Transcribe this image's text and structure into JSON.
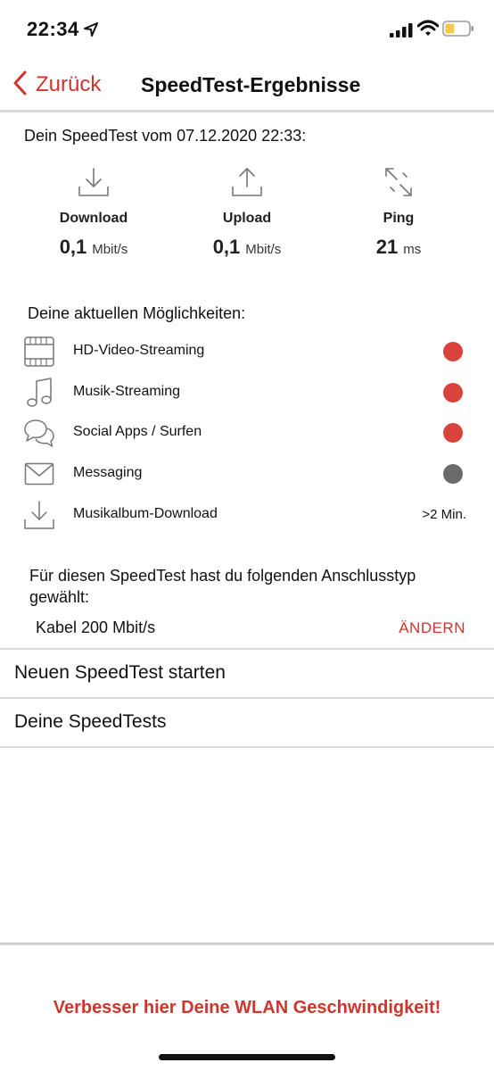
{
  "status_bar": {
    "time": "22:34",
    "location_icon": "location-arrow-icon",
    "signal_icon": "cellular-signal-icon",
    "wifi_icon": "wifi-icon",
    "battery_icon": "battery-icon",
    "battery_color": "#f2c94c"
  },
  "nav": {
    "back_label": "Zurück",
    "title": "SpeedTest-Ergebnisse"
  },
  "test": {
    "header": "Dein SpeedTest vom 07.12.2020 22:33:",
    "metrics": [
      {
        "icon": "download-icon",
        "label": "Download",
        "value": "0,1",
        "unit": "Mbit/s"
      },
      {
        "icon": "upload-icon",
        "label": "Upload",
        "value": "0,1",
        "unit": "Mbit/s"
      },
      {
        "icon": "ping-icon",
        "label": "Ping",
        "value": "21",
        "unit": "ms"
      }
    ]
  },
  "capabilities": {
    "title": "Deine aktuellen Möglichkeiten:",
    "items": [
      {
        "icon": "film-strip-icon",
        "label": "HD-Video-Streaming",
        "status": "dot",
        "color": "#d9433b"
      },
      {
        "icon": "music-note-icon",
        "label": "Musik-Streaming",
        "status": "dot",
        "color": "#d9433b"
      },
      {
        "icon": "chat-bubbles-icon",
        "label": "Social Apps / Surfen",
        "status": "dot",
        "color": "#d9433b"
      },
      {
        "icon": "envelope-icon",
        "label": "Messaging",
        "status": "dot",
        "color": "#6b6b6b"
      },
      {
        "icon": "download-icon",
        "label": "Musikalbum-Download",
        "status": "text",
        "text": ">2 Min."
      }
    ]
  },
  "connection": {
    "description": "Für diesen SpeedTest hast du folgenden Anschlusstyp gewählt:",
    "value": "Kabel 200 Mbit/s",
    "change_label": "ÄNDERN"
  },
  "list": {
    "new_test_label": "Neuen SpeedTest starten",
    "my_tests_label": "Deine SpeedTests"
  },
  "footer": {
    "link_label": "Verbesser hier Deine WLAN Geschwindigkeit!"
  },
  "colors": {
    "accent": "#d0342c",
    "divider": "#d9d9d9"
  }
}
